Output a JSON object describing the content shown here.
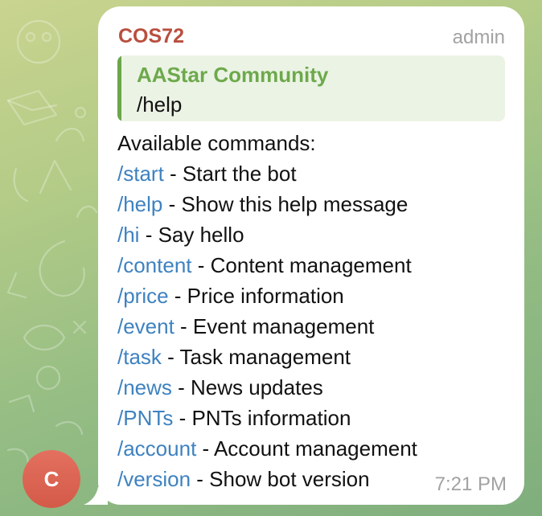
{
  "message": {
    "sender_name": "COS72",
    "sender_role": "admin",
    "avatar_initial": "C",
    "reply": {
      "author": "AAStar Community",
      "text": "/help"
    },
    "intro": "Available commands:",
    "commands": [
      {
        "cmd": "/start",
        "desc": " - Start the bot"
      },
      {
        "cmd": "/help",
        "desc": " - Show this help message"
      },
      {
        "cmd": "/hi",
        "desc": " - Say hello"
      },
      {
        "cmd": "/content",
        "desc": " - Content management"
      },
      {
        "cmd": "/price",
        "desc": " - Price information"
      },
      {
        "cmd": "/event",
        "desc": " - Event management"
      },
      {
        "cmd": "/task",
        "desc": " - Task management"
      },
      {
        "cmd": "/news",
        "desc": " - News updates"
      },
      {
        "cmd": "/PNTs",
        "desc": " - PNTs information"
      },
      {
        "cmd": "/account",
        "desc": " - Account management"
      },
      {
        "cmd": "/version",
        "desc": " - Show bot version"
      }
    ],
    "time": "7:21 PM"
  },
  "colors": {
    "sender_name": "#b94f3e",
    "link": "#3e82c0",
    "reply_accent": "#6ba64b",
    "avatar": "#d9604e"
  }
}
